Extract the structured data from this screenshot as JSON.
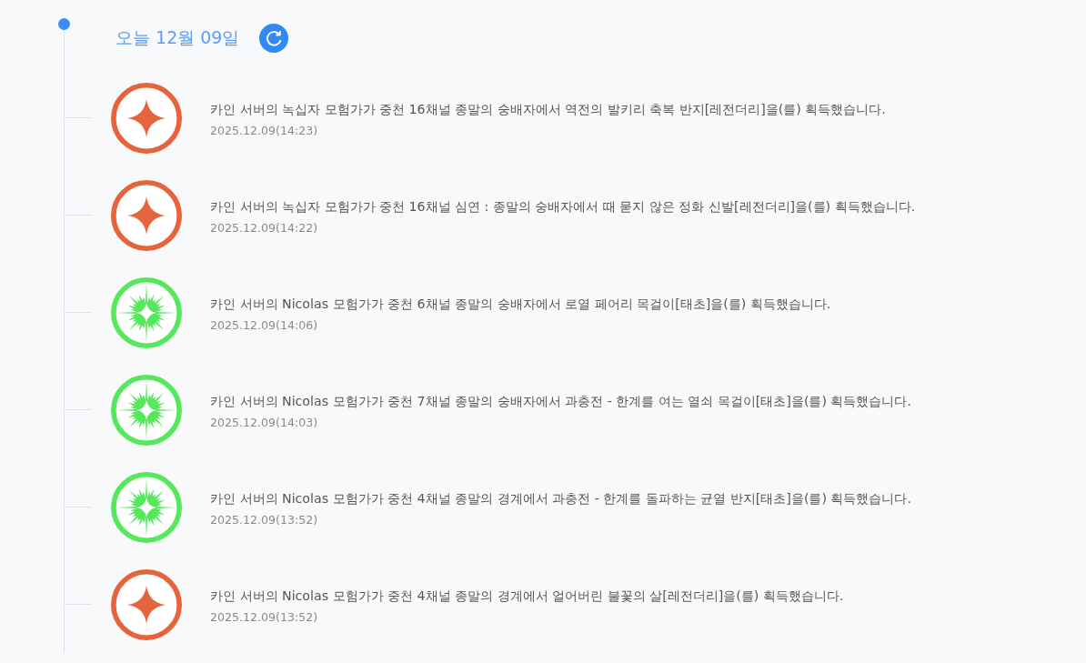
{
  "timeline": {
    "date_heading": "오늘 12월 09일",
    "entries": [
      {
        "kind": "legendary",
        "message": "카인 서버의 녹십자 모험가가 중천 16채널 종말의 숭배자에서 역전의 발키리 축복 반지[레전더리]을(를) 획득했습니다.",
        "time": "2025.12.09(14:23)"
      },
      {
        "kind": "legendary",
        "message": "카인 서버의 녹십자 모험가가 중천 16채널 심연 : 종말의 숭배자에서 때 묻지 않은 정화 신발[레전더리]을(를) 획득했습니다.",
        "time": "2025.12.09(14:22)"
      },
      {
        "kind": "primordial",
        "message": "카인 서버의 Nicolas 모험가가 중천 6채널 종말의 숭배자에서 로열 페어리 목걸이[태초]을(를) 획득했습니다.",
        "time": "2025.12.09(14:06)"
      },
      {
        "kind": "primordial",
        "message": "카인 서버의 Nicolas 모험가가 중천 7채널 종말의 숭배자에서 과충전 - 한계를 여는 열쇠 목걸이[태초]을(를) 획득했습니다.",
        "time": "2025.12.09(14:03)"
      },
      {
        "kind": "primordial",
        "message": "카인 서버의 Nicolas 모험가가 중천 4채널 종말의 경계에서 과충전 - 한계를 돌파하는 균열 반지[태초]을(를) 획득했습니다.",
        "time": "2025.12.09(13:52)"
      },
      {
        "kind": "legendary",
        "message": "카인 서버의 Nicolas 모험가가 중천 4채널 종말의 경계에서 얼어버린 불꽃의 살[레전더리]을(를) 획득했습니다.",
        "time": "2025.12.09(13:52)"
      }
    ]
  }
}
